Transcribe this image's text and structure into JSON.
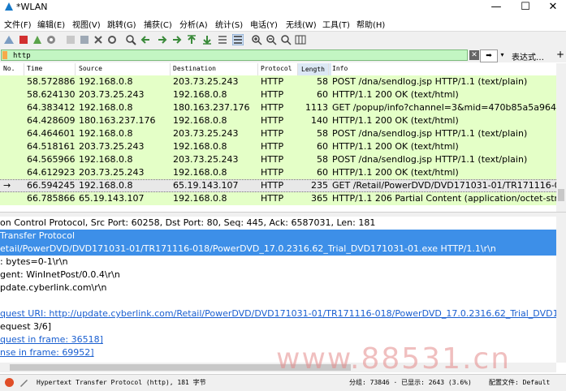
{
  "window": {
    "title": "*WLAN",
    "minimize": "—",
    "maximize": "☐",
    "close": "✕"
  },
  "menu": [
    "文件(F)",
    "编辑(E)",
    "视图(V)",
    "跳转(G)",
    "捕获(C)",
    "分析(A)",
    "统计(S)",
    "电话(Y)",
    "无线(W)",
    "工具(T)",
    "帮助(H)"
  ],
  "toolbar_icons": [
    "shark-fin-start-icon",
    "stop-capture-icon",
    "restart-capture-icon",
    "capture-options-icon",
    "open-file-icon",
    "save-file-icon",
    "close-file-icon",
    "reload-icon",
    "find-packet-icon",
    "go-back-icon",
    "go-forward-icon",
    "go-to-packet-icon",
    "go-first-icon",
    "go-last-icon",
    "auto-scroll-icon",
    "colorize-icon",
    "zoom-in-icon",
    "zoom-out-icon",
    "zoom-normal-icon",
    "resize-columns-icon"
  ],
  "filter": {
    "value": "http",
    "expression_label": "表达式…",
    "add_label": "+"
  },
  "columns": [
    "No.",
    "Time",
    "Source",
    "Destination",
    "Protocol",
    "Length",
    "Info"
  ],
  "packets": [
    {
      "time": "58.572886",
      "src": "192.168.0.8",
      "dst": "203.73.25.243",
      "proto": "HTTP",
      "len": "58",
      "info": "POST /dna/sendlog.jsp HTTP/1.1  (text/plain)"
    },
    {
      "time": "58.624130",
      "src": "203.73.25.243",
      "dst": "192.168.0.8",
      "proto": "HTTP",
      "len": "60",
      "info": "HTTP/1.1 200 OK  (text/html)"
    },
    {
      "time": "64.383412",
      "src": "192.168.0.8",
      "dst": "180.163.237.176",
      "proto": "HTTP",
      "len": "1113",
      "info": "GET /popup/info?channel=3&mid=470b85a5a964ad6..."
    },
    {
      "time": "64.428609",
      "src": "180.163.237.176",
      "dst": "192.168.0.8",
      "proto": "HTTP",
      "len": "140",
      "info": "HTTP/1.1 200 OK  (text/html)"
    },
    {
      "time": "64.464601",
      "src": "192.168.0.8",
      "dst": "203.73.25.243",
      "proto": "HTTP",
      "len": "58",
      "info": "POST /dna/sendlog.jsp HTTP/1.1  (text/plain)"
    },
    {
      "time": "64.518161",
      "src": "203.73.25.243",
      "dst": "192.168.0.8",
      "proto": "HTTP",
      "len": "60",
      "info": "HTTP/1.1 200 OK  (text/html)"
    },
    {
      "time": "64.565966",
      "src": "192.168.0.8",
      "dst": "203.73.25.243",
      "proto": "HTTP",
      "len": "58",
      "info": "POST /dna/sendlog.jsp HTTP/1.1  (text/plain)"
    },
    {
      "time": "64.612923",
      "src": "203.73.25.243",
      "dst": "192.168.0.8",
      "proto": "HTTP",
      "len": "60",
      "info": "HTTP/1.1 200 OK  (text/html)"
    },
    {
      "time": "66.594245",
      "src": "192.168.0.8",
      "dst": "65.19.143.107",
      "proto": "HTTP",
      "len": "235",
      "info": "GET /Retail/PowerDVD/DVD171031-01/TR171116-01...",
      "selected": true
    },
    {
      "time": "66.785866",
      "src": "65.19.143.107",
      "dst": "192.168.0.8",
      "proto": "HTTP",
      "len": "365",
      "info": "HTTP/1.1 206 Partial Content  (application/octet-stream)"
    }
  ],
  "details": [
    {
      "text": "on Control Protocol, Src Port: 60258, Dst Port: 80, Seq: 445, Ack: 6587031, Len: 181",
      "style": "normal"
    },
    {
      "text": "Transfer Protocol",
      "style": "hl"
    },
    {
      "text": "etail/PowerDVD/DVD171031-01/TR171116-018/PowerDVD_17.0.2316.62_Trial_DVD171031-01.exe HTTP/1.1\\r\\n",
      "style": "hl"
    },
    {
      "text": ": bytes=0-1\\r\\n",
      "style": "normal"
    },
    {
      "text": "gent: WinInetPost/0.0.4\\r\\n",
      "style": "normal"
    },
    {
      "text": "pdate.cyberlink.com\\r\\n",
      "style": "normal"
    },
    {
      "text": "",
      "style": "normal"
    },
    {
      "text": "quest URI: http://update.cyberlink.com/Retail/PowerDVD/DVD171031-01/TR171116-018/PowerDVD_17.0.2316.62_Trial_DVD171031-01.exe]",
      "style": "lnk"
    },
    {
      "text": "equest 3/6]",
      "style": "normal"
    },
    {
      "text": "quest in frame: 36518]",
      "style": "lnk"
    },
    {
      "text": "nse in frame: 69952]",
      "style": "lnk"
    }
  ],
  "status": {
    "protocol": "Hypertext Transfer Protocol (http), 181 字节",
    "packets": "分组: 73846 · 已显示: 2643 (3.6%)",
    "profile": "配置文件: Default"
  },
  "watermark": "www.88531.cn",
  "colors": {
    "row_green": "#e4ffc7",
    "filter_green": "#c3f6c3",
    "highlight_blue": "#3d8fe8"
  }
}
